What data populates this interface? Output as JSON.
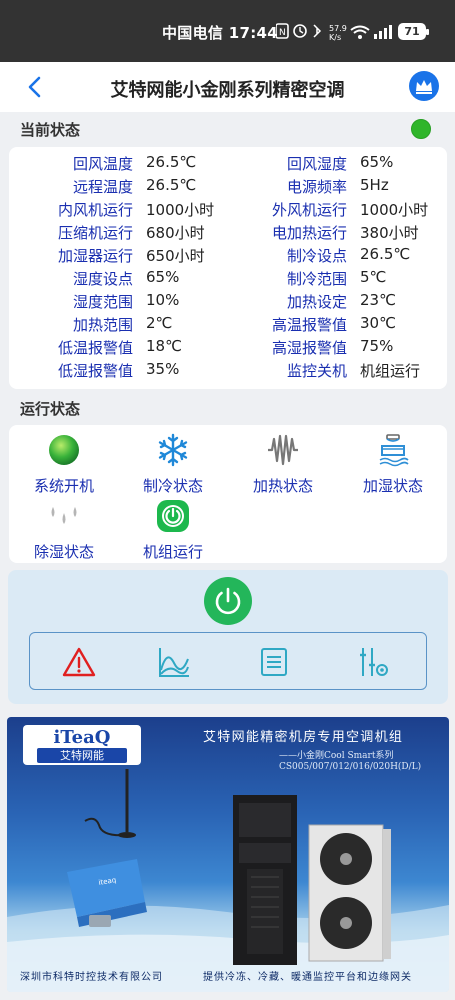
{
  "status_bar": {
    "carrier_time": "中国电信 17:44",
    "net_speed_top": "57.9",
    "net_speed_unit": "K/s",
    "battery": "71"
  },
  "appbar": {
    "title": "艾特网能小金刚系列精密空调"
  },
  "current_status": {
    "label": "当前状态",
    "indicator_color": "#2fb52a",
    "rows": [
      {
        "l1": "回风温度",
        "v1": "26.5℃",
        "l2": "回风湿度",
        "v2": "65%"
      },
      {
        "l1": "远程温度",
        "v1": "26.5℃",
        "l2": "电源频率",
        "v2": "5Hz"
      },
      {
        "l1": "内风机运行",
        "v1": "1000小时",
        "l2": "外风机运行",
        "v2": "1000小时"
      },
      {
        "l1": "压缩机运行",
        "v1": "680小时",
        "l2": "电加热运行",
        "v2": "380小时"
      },
      {
        "l1": "加湿器运行",
        "v1": "650小时",
        "l2": "制冷设点",
        "v2": "26.5℃"
      },
      {
        "l1": "湿度设点",
        "v1": "65%",
        "l2": "制冷范围",
        "v2": "5℃"
      },
      {
        "l1": "湿度范围",
        "v1": "10%",
        "l2": "加热设定",
        "v2": "23℃"
      },
      {
        "l1": "加热范围",
        "v1": "2℃",
        "l2": "高温报警值",
        "v2": "30℃"
      },
      {
        "l1": "低温报警值",
        "v1": "18℃",
        "l2": "高湿报警值",
        "v2": "75%"
      },
      {
        "l1": "低湿报警值",
        "v1": "35%",
        "l2": "监控关机",
        "v2": "机组运行"
      }
    ]
  },
  "run_status": {
    "label": "运行状态",
    "items": [
      {
        "label": "系统开机",
        "icon": "green-ball-icon"
      },
      {
        "label": "制冷状态",
        "icon": "snowflake-icon"
      },
      {
        "label": "加热状态",
        "icon": "heater-icon"
      },
      {
        "label": "加湿状态",
        "icon": "humidifier-icon"
      },
      {
        "label": "除湿状态",
        "icon": "droplets-icon"
      },
      {
        "label": "机组运行",
        "icon": "power-running-icon"
      }
    ]
  },
  "controls": {
    "power_color": "#23b65a",
    "tools": [
      "alarm-icon",
      "chart-icon",
      "list-icon",
      "settings-sliders-icon"
    ]
  },
  "banner": {
    "logo_brand": "iTeaQ",
    "logo_sub": "艾特网能",
    "title": "艾特网能精密机房专用空调机组",
    "subtitle": "——小金刚Cool Smart系列",
    "models": "CS005/007/012/016/020H(D/L)",
    "footer_left": "深圳市科特时控技术有限公司",
    "footer_right": "提供冷冻、冷藏、暖通监控平台和边缘网关"
  }
}
